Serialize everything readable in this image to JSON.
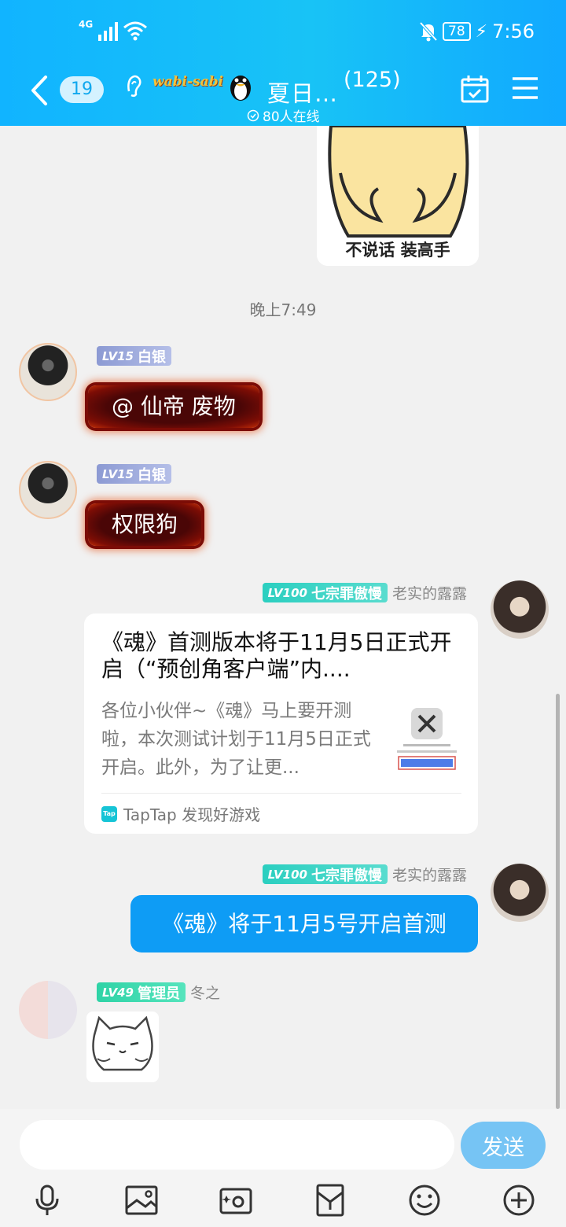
{
  "status_bar": {
    "network": "4G",
    "battery": "78",
    "time": "7:56"
  },
  "header": {
    "unread_count": "19",
    "logo_text": "wabi-sabi",
    "group_name": "夏日…",
    "member_count": "(125)",
    "online_text": "80人在线"
  },
  "chat": {
    "top_sticker_caption": "不说话 装高手",
    "time_divider": "晚上7:49",
    "messages": [
      {
        "level": "LV15",
        "title": "白银",
        "name": "",
        "text": "@ 仙帝 废物"
      },
      {
        "level": "LV15",
        "title": "白银",
        "name": "",
        "text": "权限狗"
      },
      {
        "level": "LV100",
        "title": "七宗罪傲慢",
        "name": "老实的露露",
        "card": {
          "title": "《魂》首测版本将于11月5日正式开启（“预创角客户端”内....",
          "description": "各位小伙伴~《魂》马上要开测啦，本次测试计划于11月5日正式开启。此外，为了让更...",
          "source_logo": "Tap",
          "source": "TapTap 发现好游戏"
        }
      },
      {
        "level": "LV100",
        "title": "七宗罪傲慢",
        "name": "老实的露露",
        "text": "《魂》将于11月5号开启首测"
      },
      {
        "level": "LV49",
        "title": "管理员",
        "name": "冬之"
      }
    ]
  },
  "input": {
    "placeholder": "",
    "send_label": "发送"
  },
  "colors": {
    "header": "#18b8fa",
    "bubble_blue": "#0e9cf5",
    "send_button": "#76c4f4"
  }
}
